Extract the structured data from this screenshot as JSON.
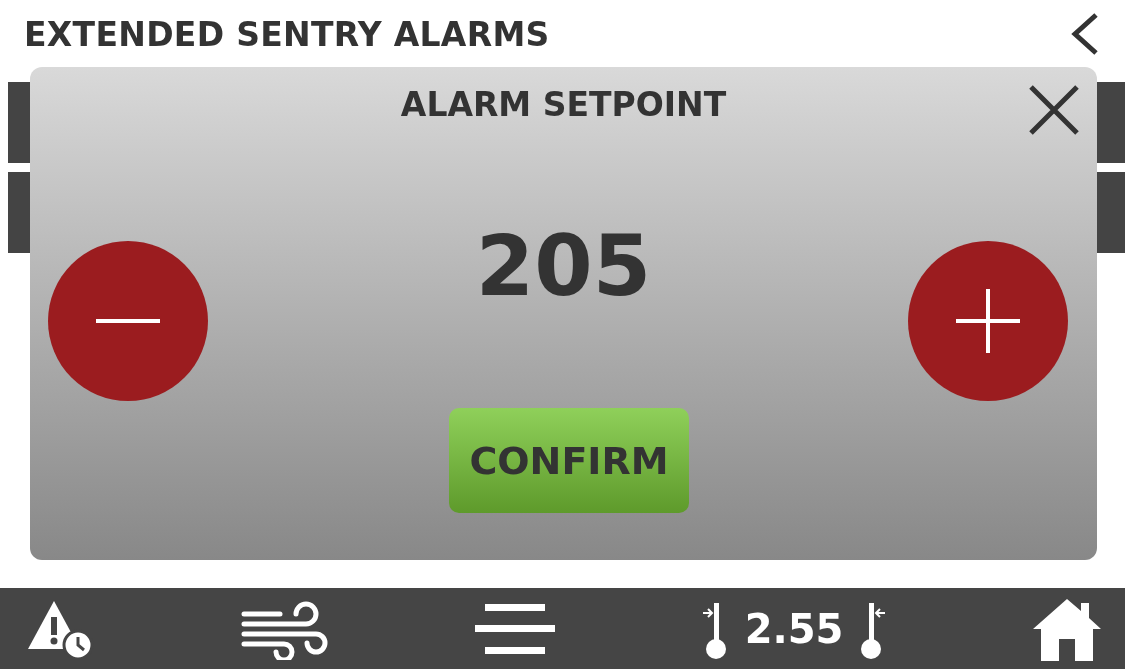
{
  "header": {
    "title": "EXTENDED SENTRY ALARMS"
  },
  "background_rows": [
    {
      "kind": "row"
    },
    {
      "kind": "row"
    }
  ],
  "dialog": {
    "title": "ALARM SETPOINT",
    "value": "205",
    "confirm": "CONFIRM"
  },
  "bottom_bar": {
    "reading": "2.55"
  }
}
